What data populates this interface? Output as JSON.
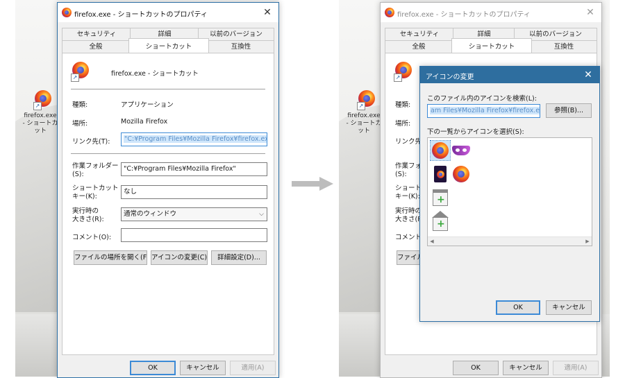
{
  "shortcut_name": "firefox.exe - ショートカット",
  "desktop_icon": {
    "line1": "firefox.exe",
    "line2": "- ショートカット"
  },
  "properties": {
    "title": "firefox.exe - ショートカットのプロパティ",
    "tabs_row1": [
      "セキュリティ",
      "詳細",
      "以前のバージョン"
    ],
    "tabs_row2": [
      "全般",
      "ショートカット",
      "互換性"
    ],
    "active_tab": "ショートカット",
    "fields": {
      "type_label": "種類:",
      "type_value": "アプリケーション",
      "location_label": "場所:",
      "location_value": "Mozilla Firefox",
      "target_label": "リンク先(T):",
      "target_value": "\"C:¥Program Files¥Mozilla Firefox¥firefox.exe\"",
      "startin_label1": "作業フォルダー",
      "startin_label2": "(S):",
      "startin_value": "\"C:¥Program Files¥Mozilla Firefox\"",
      "hotkey_label1": "ショートカット",
      "hotkey_label2": "キー(K):",
      "hotkey_value": "なし",
      "run_label1": "実行時の",
      "run_label2": "大きさ(R):",
      "run_value": "通常のウィンドウ",
      "comment_label": "コメント(O):",
      "comment_value": ""
    },
    "buttons": {
      "open_location": "ファイルの場所を開く(F)",
      "change_icon": "アイコンの変更(C)...",
      "advanced": "詳細設定(D)...",
      "ok": "OK",
      "cancel": "キャンセル",
      "apply": "適用(A)"
    }
  },
  "change_icon_dialog": {
    "title": "アイコンの変更",
    "search_label": "このファイル内のアイコンを検索(L):",
    "search_value": "am Files¥Mozilla Firefox¥firefox.exe",
    "browse": "参照(B)...",
    "list_label": "下の一覧からアイコンを選択(S):",
    "icons": [
      "firefox-icon",
      "private-mask-icon",
      "firefox-dark-icon",
      "firefox-icon",
      "new-window-icon",
      "new-tab-home-icon"
    ],
    "ok": "OK",
    "cancel": "キャンセル"
  },
  "colors": {
    "accent": "#3c8ad6",
    "titlebar_border": "#2d6fa5",
    "selection": "#cfe6fb"
  }
}
